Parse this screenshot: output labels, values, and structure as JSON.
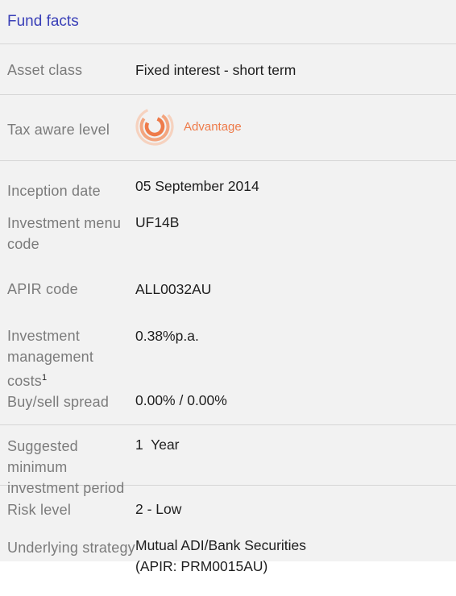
{
  "header": {
    "title": "Fund facts"
  },
  "rows": {
    "asset_class": {
      "label": "Asset class",
      "value": "Fixed interest - short term"
    },
    "tax_aware": {
      "label": "Tax aware level",
      "value": "Advantage",
      "icon": "advantage-rings-icon"
    },
    "inception": {
      "label": "Inception date",
      "value": "05 September 2014"
    },
    "menu_code": {
      "label_line1": "Investment menu",
      "label_line2": "code",
      "value": "UF14B"
    },
    "apir": {
      "label": "APIR code",
      "value": "ALL0032AU"
    },
    "costs": {
      "label_line1": "Investment",
      "label_line2": "management costs",
      "label_sup": "1",
      "value": "0.38%p.a."
    },
    "spread": {
      "label": "Buy/sell spread",
      "value": "0.00% / 0.00%"
    },
    "min_period": {
      "label_line1": "Suggested minimum",
      "label_line2": "investment period",
      "value": "1  Year"
    },
    "risk": {
      "label": "Risk level",
      "value": "2 - Low"
    },
    "strategy": {
      "label": "Underlying strategy",
      "value_line1": "Mutual ADI/Bank Securities",
      "value_line2": "(APIR: PRM0015AU)"
    }
  },
  "colors": {
    "header_text": "#3a40b8",
    "label_text": "#7b7b7b",
    "value_text": "#1e1e1e",
    "advantage_accent": "#ee7b4a",
    "background": "#f2f2f2"
  }
}
